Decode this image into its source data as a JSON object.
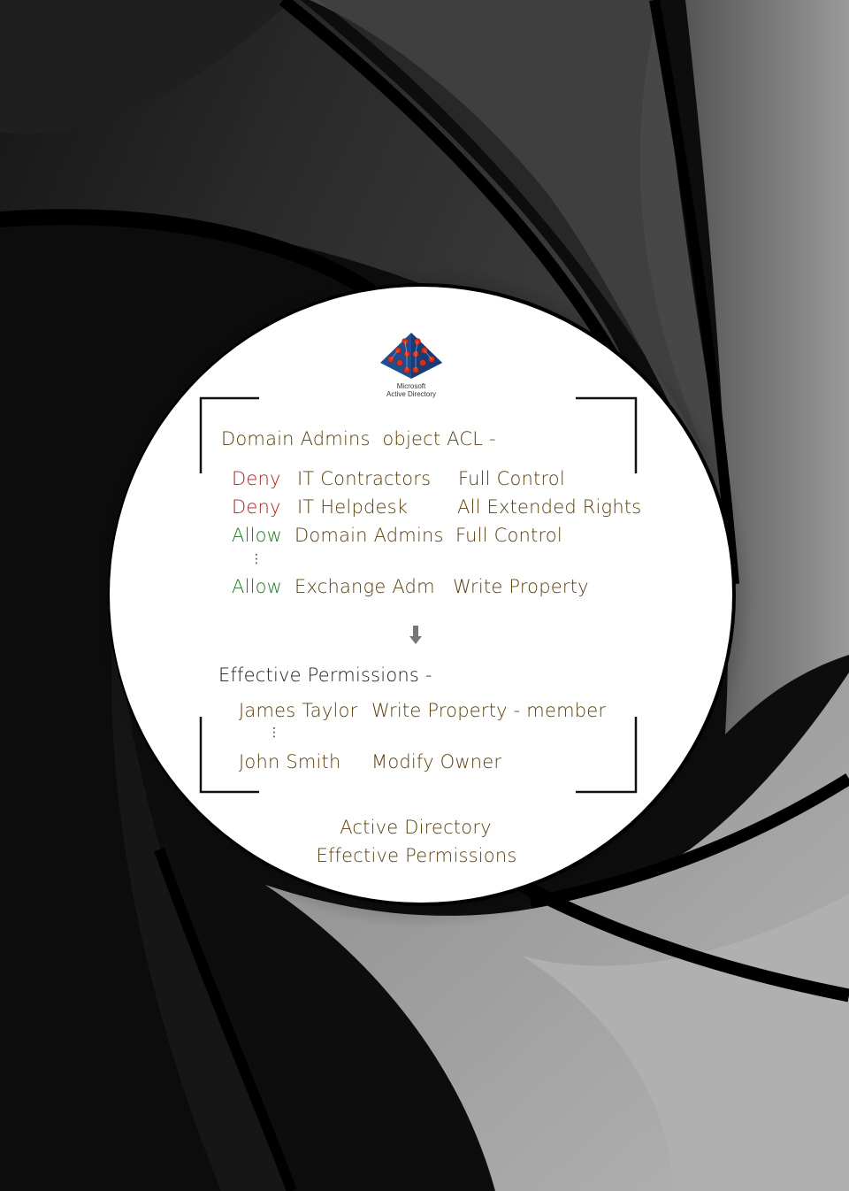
{
  "logo": {
    "icon": "active-directory-pyramid-icon",
    "caption_line1": "Microsoft",
    "caption_line2": "Active Directory"
  },
  "acl": {
    "title": "Domain Admins  object ACL -",
    "entries": [
      {
        "type": "Deny",
        "principal": "IT Contractors",
        "permission": "Full Control"
      },
      {
        "type": "Deny",
        "principal": "IT Helpdesk",
        "permission": "All Extended Rights"
      },
      {
        "type": "Allow",
        "principal": "Domain Admins",
        "permission": "Full Control"
      },
      {
        "type": "Allow",
        "principal": "Exchange Adm",
        "permission": "Write Property"
      }
    ],
    "ellipsis": "⋮"
  },
  "arrow_icon": "down-arrow-icon",
  "effective": {
    "title": "Effective Permissions -",
    "entries": [
      {
        "user": "James Taylor",
        "permission": "Write Property - member"
      },
      {
        "user": "John Smith",
        "permission": "Modify Owner"
      }
    ],
    "ellipsis": "⋮"
  },
  "footer": {
    "line1": "Active Directory",
    "line2": "Effective Permissions"
  },
  "colors": {
    "deny": "#b01c1c",
    "allow": "#1c7a24",
    "text": "#5a3e0c"
  }
}
